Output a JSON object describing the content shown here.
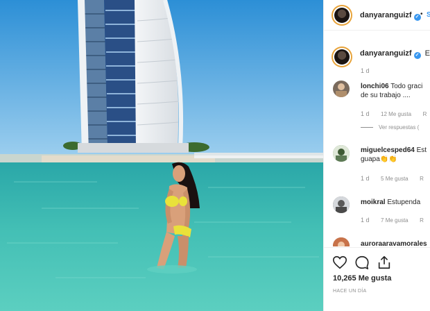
{
  "post": {
    "username": "danyaranguizf",
    "follow_label": "S",
    "caption_preview": "En",
    "caption_age": "1 d"
  },
  "comments": [
    {
      "user": "lonchi06",
      "text_line1": "Todo graci",
      "text_line2": "de su trabajo ....",
      "age": "1 d",
      "likes": "12 Me gusta",
      "reply": "R",
      "view_replies": "Ver respuestas (",
      "avatar_color": "#7a6a5c"
    },
    {
      "user": "miguelcesped64",
      "text_line1": "Est",
      "text_line2": "guapa👏👏",
      "age": "1 d",
      "likes": "5 Me gusta",
      "reply": "R",
      "avatar_color": "#5d7a55"
    },
    {
      "user": "moikral",
      "text_line1": "Estupenda",
      "age": "1 d",
      "likes": "7 Me gusta",
      "reply": "R",
      "avatar_color": "#4a4a4a"
    },
    {
      "user": "auroraaravamorales",
      "avatar_color": "#a0522d"
    }
  ],
  "actions": {
    "like_icon": "heart-icon",
    "comment_icon": "comment-icon",
    "share_icon": "share-icon",
    "likes_count": "10,265 Me gusta",
    "posted_age": "HACE UN DÍA"
  },
  "colors": {
    "verified": "#3897f0",
    "story_ring": "#e8a33a",
    "muted_text": "#8e8e8e"
  }
}
